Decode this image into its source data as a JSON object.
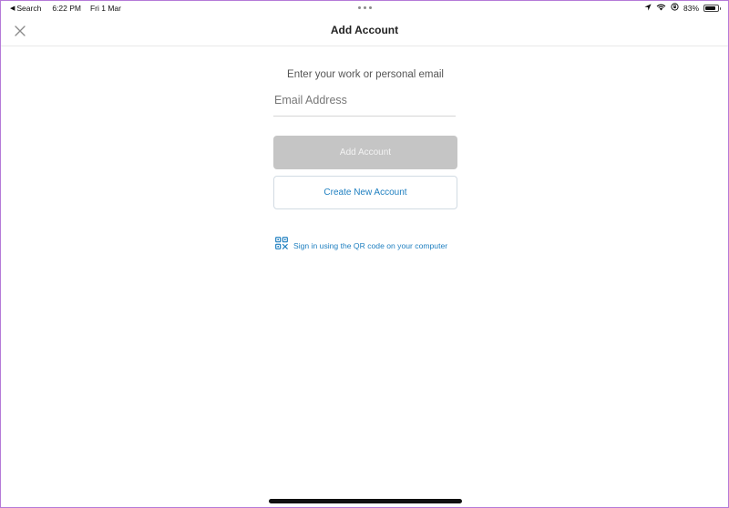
{
  "status_bar": {
    "back_label": "Search",
    "time": "6:22 PM",
    "date": "Fri 1 Mar",
    "battery_percent": "83%",
    "battery_level": 0.83,
    "icons": [
      "location-arrow-icon",
      "wifi-icon",
      "orientation-lock-icon",
      "battery-icon"
    ]
  },
  "nav": {
    "title": "Add Account",
    "close_icon": "close-icon"
  },
  "form": {
    "prompt": "Enter your work or personal email",
    "email_placeholder": "Email Address",
    "email_value": "",
    "add_account_label": "Add Account",
    "create_account_label": "Create New Account",
    "qr_signin_label": "Sign in using the QR code on your computer"
  },
  "colors": {
    "accent": "#1e7fc0",
    "disabled_button": "#c5c5c5",
    "frame_border": "#b57ad8"
  }
}
